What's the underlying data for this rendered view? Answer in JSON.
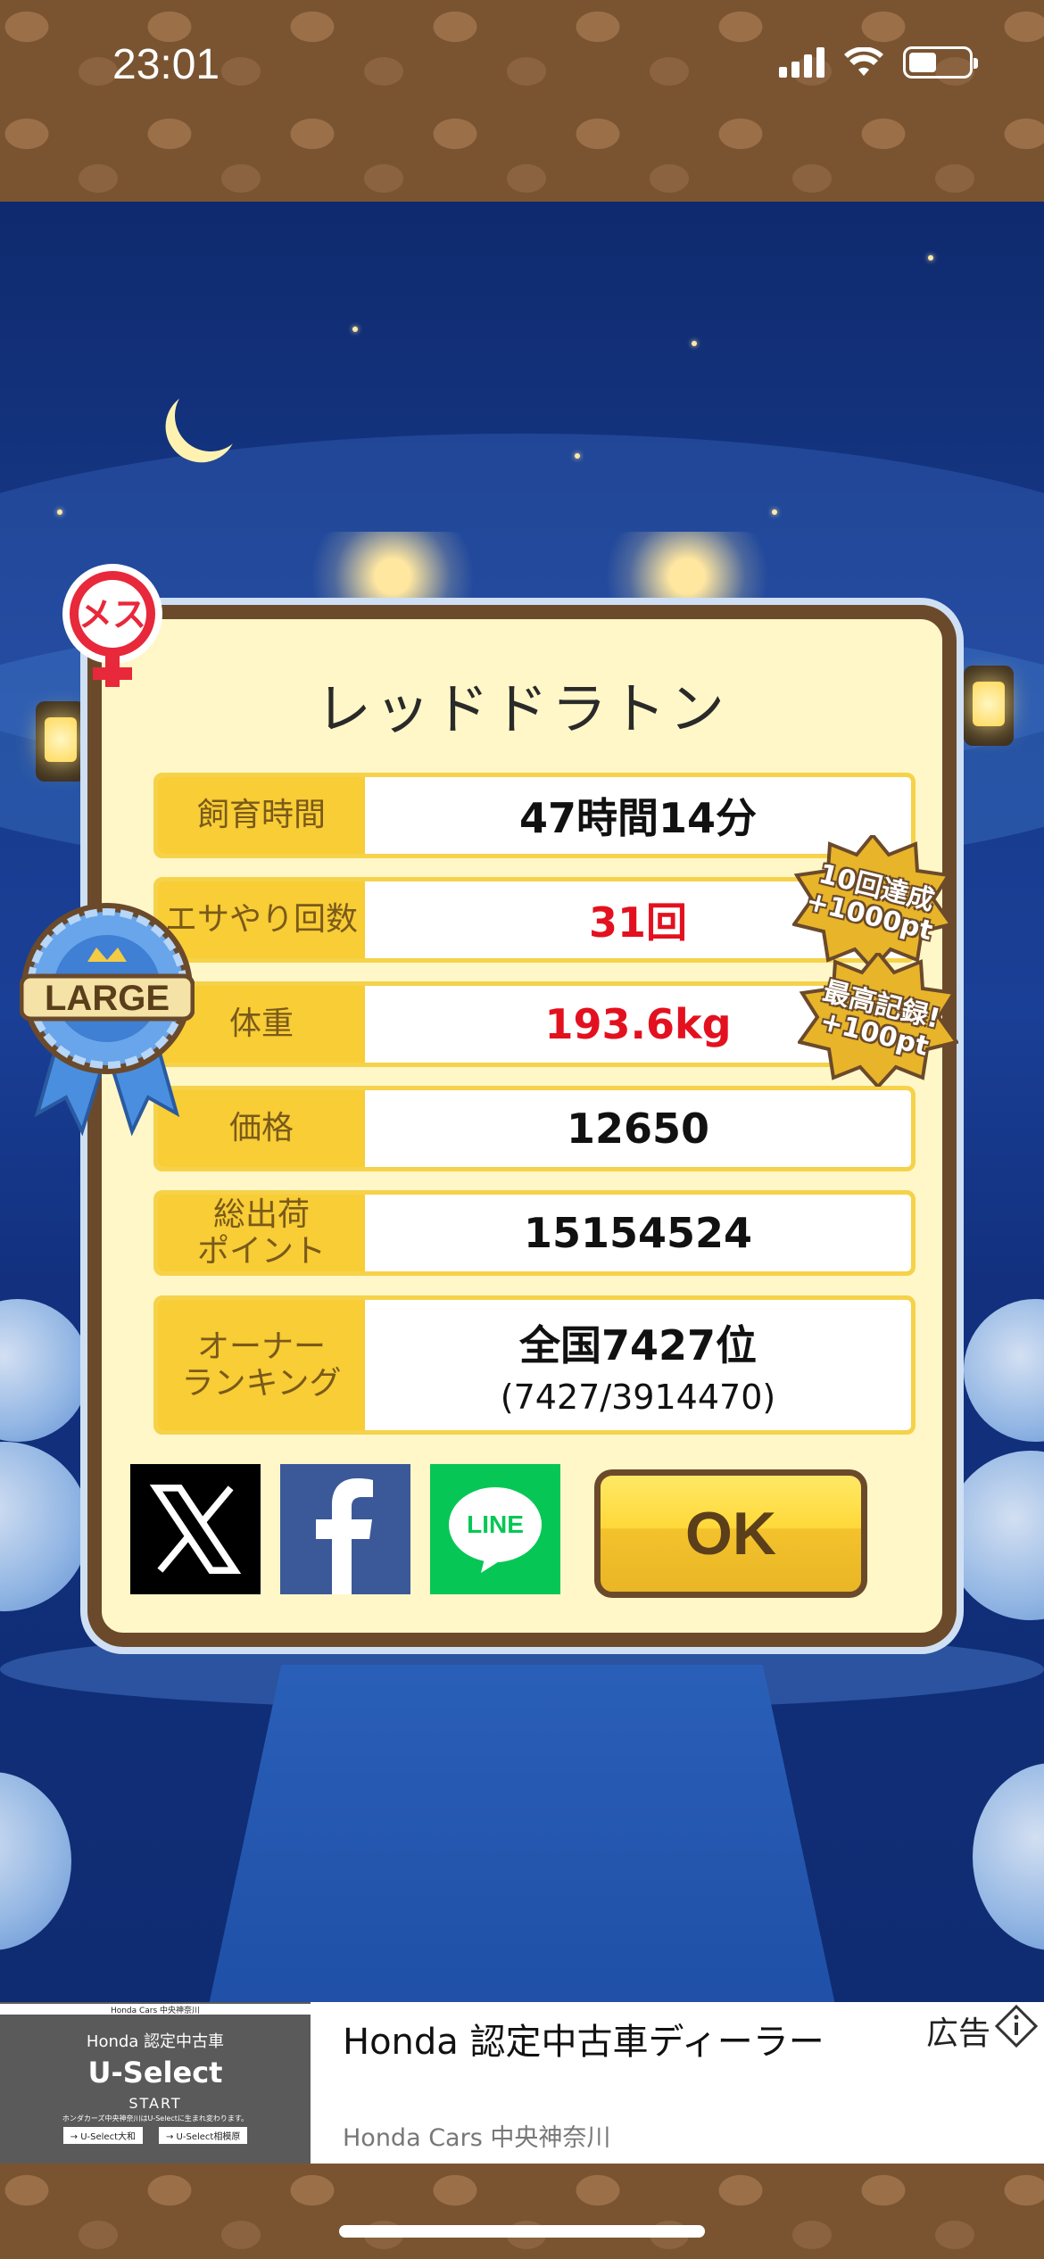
{
  "status_bar": {
    "time": "23:01",
    "icons": [
      "signal-icon",
      "wifi-icon",
      "battery-icon"
    ]
  },
  "badges": {
    "gender": "メス",
    "size_ribbon": "LARGE",
    "achievement_1": "10回達成\n+1000pt",
    "achievement_2": "最高記録!\n+100pt"
  },
  "dialog": {
    "title": "レッドドラトン",
    "rows": [
      {
        "label": "飼育時間",
        "value": "47時間14分"
      },
      {
        "label": "エサやり回数",
        "value": "31回"
      },
      {
        "label": "体重",
        "value": "193.6kg"
      },
      {
        "label": "価格",
        "value": "12650"
      },
      {
        "label": "総出荷\nポイント",
        "value": "15154524"
      },
      {
        "label": "オーナー\nランキング",
        "value": "全国7427位",
        "sub": "(7427/3914470)"
      }
    ],
    "share": {
      "line_label": "LINE"
    },
    "ok_label": "OK"
  },
  "ad": {
    "image": {
      "small_caption": "Honda Cars 中央神奈川",
      "line1": "Honda 認定中古車",
      "line2": "U-Select",
      "line3": "START",
      "line4": "ホンダカーズ中央神奈川はU-Selectに生まれ変わります。",
      "btn1": "→ U-Select大和",
      "btn2": "→ U-Select相模原"
    },
    "title": "Honda 認定中古車ディーラー",
    "advertiser": "Honda Cars 中央神奈川",
    "label": "広告"
  },
  "colors": {
    "accent": "#f8cd35",
    "frame": "#6b4a2b",
    "highlight_red": "#e3111f",
    "panel": "#fff7c8"
  }
}
